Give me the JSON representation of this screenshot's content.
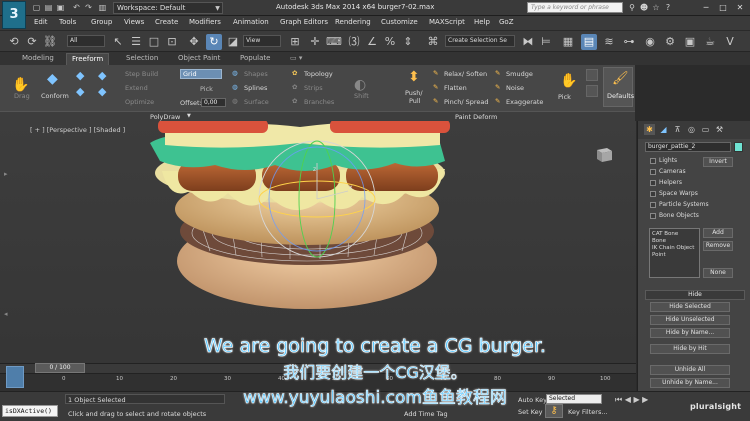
{
  "app": {
    "logo": "3",
    "workspace": "Workspace: Default",
    "title": "Autodesk 3ds Max  2014 x64     burger7-02.max",
    "search_placeholder": "Type a keyword or phrase"
  },
  "menu": [
    "Edit",
    "Tools",
    "Group",
    "Views",
    "Create",
    "Modifiers",
    "Animation",
    "Graph Editors",
    "Rendering",
    "Customize",
    "MAXScript",
    "Help",
    "GoZ"
  ],
  "toolbar": {
    "filter": "All",
    "view": "View",
    "selection_set": "Create Selection Se"
  },
  "ribbon": {
    "tabs": [
      "Modeling",
      "Freeform",
      "Selection",
      "Object Paint",
      "Populate"
    ],
    "active_tab": "Freeform",
    "drag": "Drag",
    "conform": "Conform",
    "step_build": "Step Build",
    "extend": "Extend",
    "optimize": "Optimize",
    "grid": "Grid",
    "pick": "Pick",
    "offset_label": "Offset:",
    "offset_value": "0,00",
    "shapes": "Shapes",
    "splines": "Splines",
    "surface": "Surface",
    "topology": "Topology",
    "strips": "Strips",
    "branches": "Branches",
    "shift": "Shift",
    "push_pull": "Push/\nPull",
    "relax_soften": "Relax/ Soften",
    "flatten": "Flatten",
    "pinch_spread": "Pinch/ Spread",
    "smudge": "Smudge",
    "noise": "Noise",
    "exaggerate": "Exaggerate",
    "pick2": "Pick",
    "defaults": "Defaults",
    "footer_polydraw": "PolyDraw",
    "footer_paint_deform": "Paint Deform"
  },
  "viewport": {
    "label": "[ + ] [Perspective ] [Shaded ]"
  },
  "command_panel": {
    "object_name": "burger_pattie_2",
    "invert": "Invert",
    "checks": [
      "Lights",
      "Cameras",
      "Helpers",
      "Space Warps",
      "Particle Systems",
      "Bone Objects"
    ],
    "list": [
      "CAT Bone",
      "Bone",
      "IK Chain Object",
      "Point"
    ],
    "add": "Add",
    "remove": "Remove",
    "none": "None",
    "hide_rollout": "Hide",
    "hide_buttons": [
      "Hide Selected",
      "Hide Unselected",
      "Hide by Name...",
      "Hide by Hit",
      "Unhide All",
      "Unhide by Name..."
    ]
  },
  "timeline": {
    "slider": "0 / 100",
    "ticks": [
      "0",
      "10",
      "20",
      "30",
      "40",
      "50",
      "60",
      "70",
      "80",
      "90",
      "100"
    ]
  },
  "status": {
    "maxscript": "isDXActive()",
    "objects_selected": "1 Object Selected",
    "hint": "Click and drag to select and rotate objects",
    "add_time_tag": "Add Time Tag",
    "auto_key": "Auto Key",
    "selected": "Selected",
    "set_key": "Set Key",
    "key_filters": "Key Filters...",
    "watermark": "pluralsight"
  },
  "subtitles": {
    "english": "We are going to create a CG burger.",
    "chinese": "我们要创建一个CG汉堡。",
    "url": "www.yuyulaoshi.com鱼鱼教程网"
  },
  "colors": {
    "accent": "#5a86b6",
    "bun": "#e3c290",
    "cheese": "#efe7a2",
    "lettuce": "#3ec291",
    "tomato": "#d9523c",
    "patty": "#a9592f",
    "object_color": "#6fe3d3",
    "subtitle": "#5fc9ff"
  }
}
